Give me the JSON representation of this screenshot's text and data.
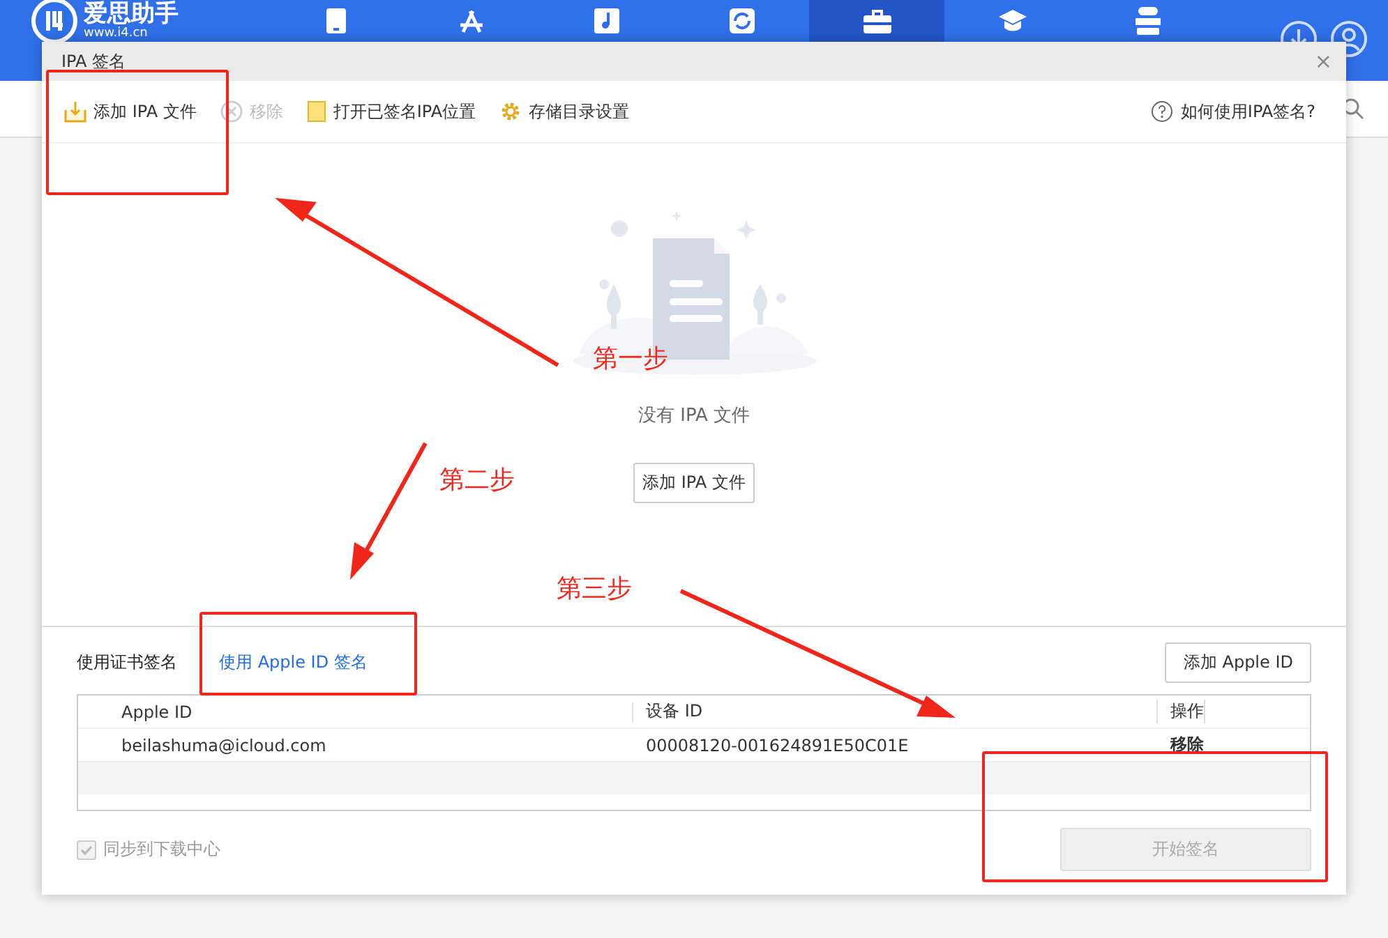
{
  "app": {
    "name": "爱思助手",
    "url": "www.i4.cn"
  },
  "nav": [
    {
      "kind": "phone",
      "selected": false
    },
    {
      "kind": "apps",
      "selected": false
    },
    {
      "kind": "music",
      "selected": false
    },
    {
      "kind": "sync",
      "selected": false
    },
    {
      "kind": "toolbox",
      "selected": true
    },
    {
      "kind": "tutorial",
      "selected": false
    },
    {
      "kind": "flash",
      "selected": false
    }
  ],
  "dialog": {
    "title": "IPA 签名",
    "close": "×",
    "toolbar": [
      {
        "kind": "add",
        "label": "添加 IPA 文件",
        "disabled": false
      },
      {
        "kind": "remove",
        "label": "移除",
        "disabled": true
      },
      {
        "kind": "folder",
        "label": "打开已签名IPA位置",
        "disabled": false
      },
      {
        "kind": "gear",
        "label": "存储目录设置",
        "disabled": false
      }
    ],
    "help": "如何使用IPA签名?",
    "empty": {
      "message": "没有 IPA 文件",
      "button": "添加 IPA 文件"
    },
    "tabs": [
      {
        "label": "使用证书签名",
        "selected": false
      },
      {
        "label": "使用 Apple ID 签名",
        "selected": true
      }
    ],
    "add_apple_id": "添加 Apple ID",
    "table": {
      "columns": [
        "Apple ID",
        "设备 ID",
        "操作"
      ],
      "rows": [
        {
          "apple_id": "beilashuma@icloud.com",
          "device_id": "00008120-001624891E50C01E",
          "action": "移除"
        }
      ]
    },
    "sync": {
      "label": "同步到下载中心",
      "checked": true,
      "disabled": true
    },
    "start": {
      "label": "开始签名",
      "disabled": true
    }
  },
  "annotations": [
    "第一步",
    "第二步",
    "第三步"
  ]
}
